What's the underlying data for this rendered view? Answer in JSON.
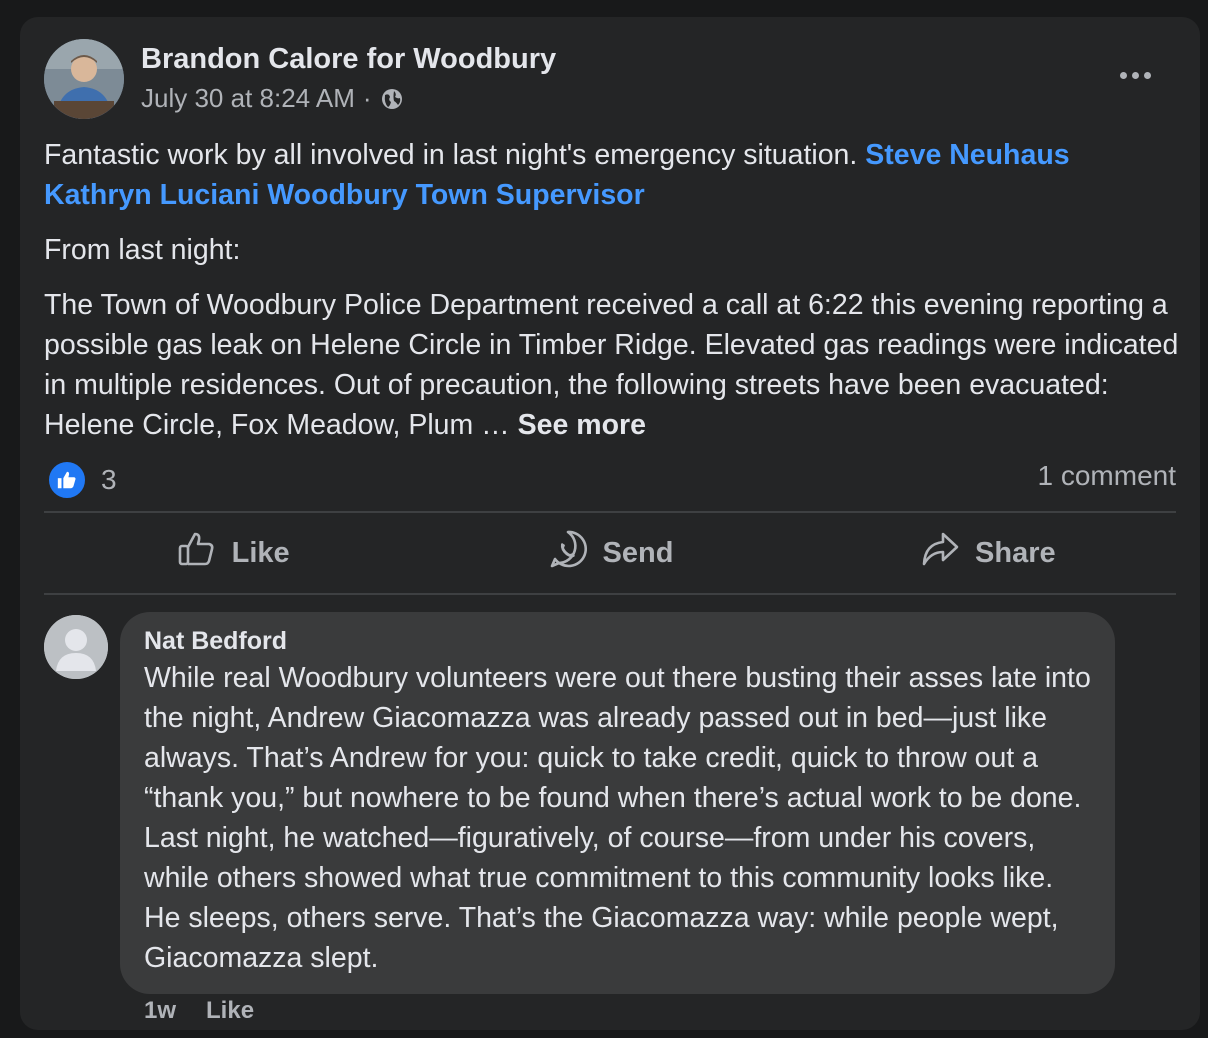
{
  "post": {
    "author": "Brandon Calore for Woodbury",
    "timestamp": "July 30 at 8:24 AM",
    "separator": "·",
    "privacy_icon": "globe-icon",
    "text_intro": "Fantastic work by all involved in last night's emergency situation.",
    "mentions": [
      "Steve Neuhaus",
      "Kathryn Luciani",
      "Woodbury Town Supervisor"
    ],
    "from_label": "From last night:",
    "body": "The Town of Woodbury Police Department received a call at 6:22 this evening reporting a possible gas leak on Helene Circle in Timber Ridge. Elevated gas readings were indicated in multiple residences. Out of precaution, the following streets have been evacuated: Helene Circle, Fox Meadow, Plum …",
    "see_more": "See more",
    "reaction_count": "3",
    "comment_count": "1 comment"
  },
  "actions": {
    "like": "Like",
    "send": "Send",
    "share": "Share"
  },
  "comment": {
    "author": "Nat Bedford",
    "text": "While real Woodbury volunteers were out there busting their asses late into the night, Andrew Giacomazza was already passed out in bed—just like always. That’s Andrew for you: quick to take credit, quick to throw out a “thank you,” but nowhere to be found when there’s actual work to be done. Last night, he watched—figuratively, of course—from under his covers, while others showed what true commitment to this community looks like. He sleeps, others serve. That’s the Giacomazza way: while people wept, Giacomazza slept.",
    "age": "1w",
    "like": "Like"
  },
  "colors": {
    "card_bg": "#242526",
    "page_bg": "#18191a",
    "mention": "#4599ff",
    "like_blue": "#2078f4",
    "bubble_bg": "#3a3b3c"
  }
}
